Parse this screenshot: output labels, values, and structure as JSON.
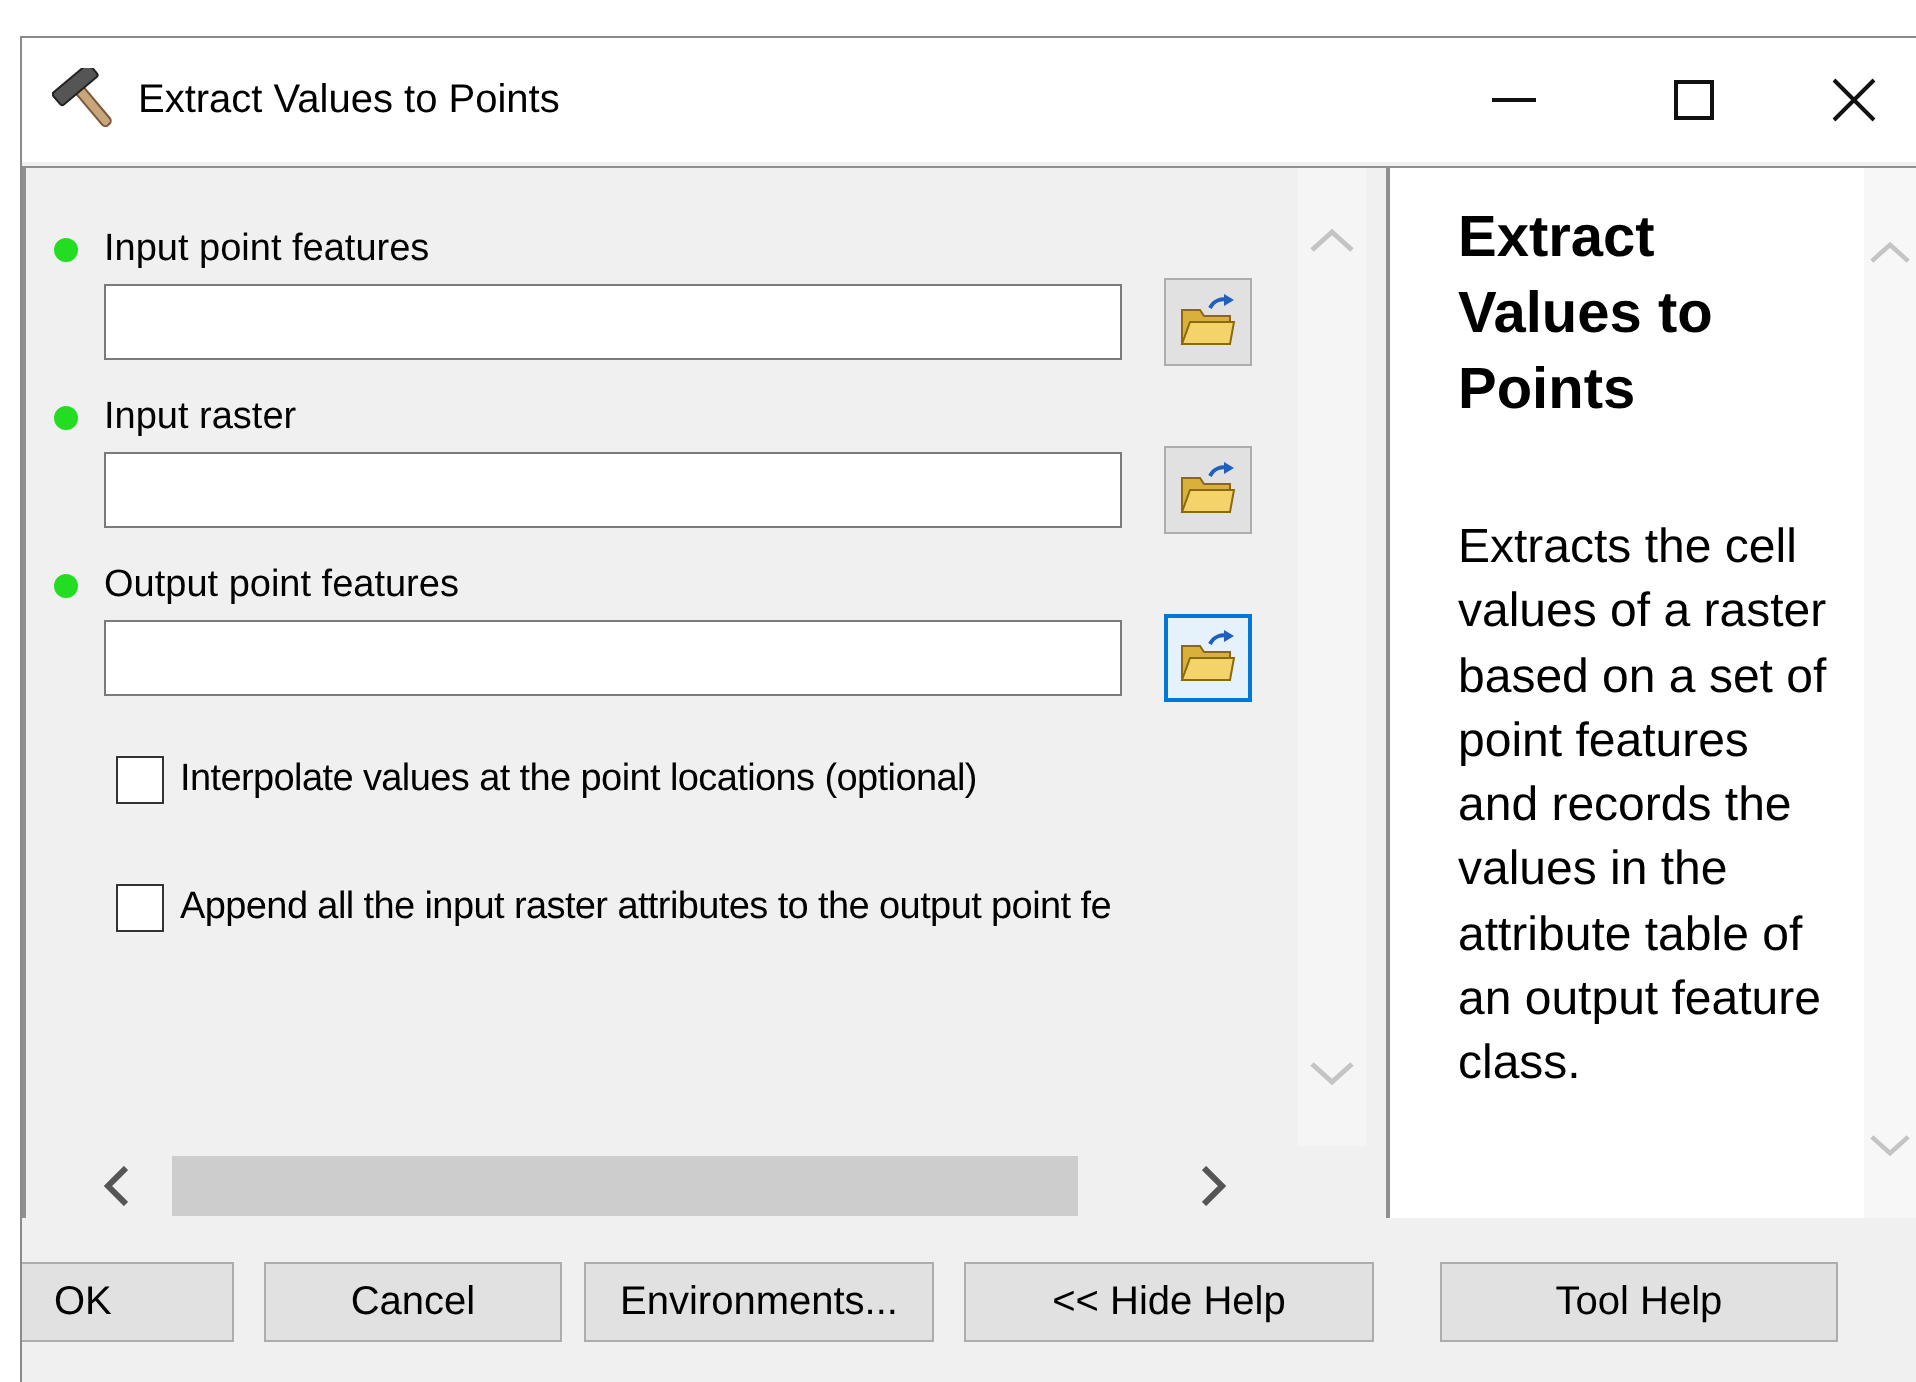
{
  "window": {
    "title": "Extract Values to Points"
  },
  "parameters": [
    {
      "kind": "field",
      "label": "Input point features",
      "required": true,
      "focused": false
    },
    {
      "kind": "field",
      "label": "Input raster",
      "required": true,
      "focused": false
    },
    {
      "kind": "field",
      "label": "Output point features",
      "required": true,
      "focused": true
    },
    {
      "kind": "checkbox",
      "label": "Interpolate values at the point locations (optional)",
      "checked": false
    },
    {
      "kind": "checkbox",
      "label": "Append all the input raster attributes to the output point fe",
      "checked": false
    }
  ],
  "help": {
    "title": "Extract Values to Points",
    "description": "Extracts the cell values of a raster based on a set of point features and records the values in the attribute table of an output feature class."
  },
  "buttons": [
    "OK",
    "Cancel",
    "Environments...",
    "<< Hide Help",
    "Tool Help"
  ]
}
